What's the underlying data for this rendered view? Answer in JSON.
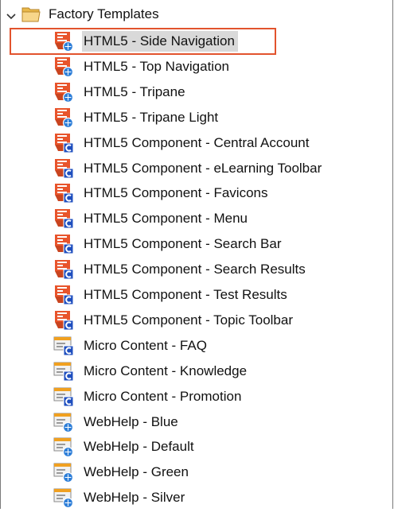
{
  "tree": {
    "folder": {
      "label": "Factory Templates",
      "icon": "folder-open-icon",
      "expanded": true
    },
    "items": [
      {
        "label": "HTML5 - Side Navigation",
        "icon": "html5-skin-icon",
        "selected": true
      },
      {
        "label": "HTML5 - Top Navigation",
        "icon": "html5-skin-icon"
      },
      {
        "label": "HTML5 - Tripane",
        "icon": "html5-skin-icon"
      },
      {
        "label": "HTML5 - Tripane Light",
        "icon": "html5-skin-icon"
      },
      {
        "label": "HTML5 Component - Central Account",
        "icon": "html5-component-icon"
      },
      {
        "label": "HTML5 Component - eLearning Toolbar",
        "icon": "html5-component-icon"
      },
      {
        "label": "HTML5 Component - Favicons",
        "icon": "html5-component-icon"
      },
      {
        "label": "HTML5 Component - Menu",
        "icon": "html5-component-icon"
      },
      {
        "label": "HTML5 Component - Search Bar",
        "icon": "html5-component-icon"
      },
      {
        "label": "HTML5 Component - Search Results",
        "icon": "html5-component-icon"
      },
      {
        "label": "HTML5 Component - Test Results",
        "icon": "html5-component-icon"
      },
      {
        "label": "HTML5 Component - Topic Toolbar",
        "icon": "html5-component-icon"
      },
      {
        "label": "Micro Content - FAQ",
        "icon": "micro-content-icon"
      },
      {
        "label": "Micro Content - Knowledge",
        "icon": "micro-content-icon"
      },
      {
        "label": "Micro Content - Promotion",
        "icon": "micro-content-icon"
      },
      {
        "label": "WebHelp - Blue",
        "icon": "webhelp-skin-icon"
      },
      {
        "label": "WebHelp - Default",
        "icon": "webhelp-skin-icon"
      },
      {
        "label": "WebHelp - Green",
        "icon": "webhelp-skin-icon"
      },
      {
        "label": "WebHelp - Silver",
        "icon": "webhelp-skin-icon"
      }
    ]
  },
  "colors": {
    "highlight_border": "#e2532d",
    "selected_bg": "#d9d9d9",
    "html5_orange": "#e8542b",
    "component_blue": "#1f4fbf",
    "webhelp_orange": "#f0a020"
  }
}
